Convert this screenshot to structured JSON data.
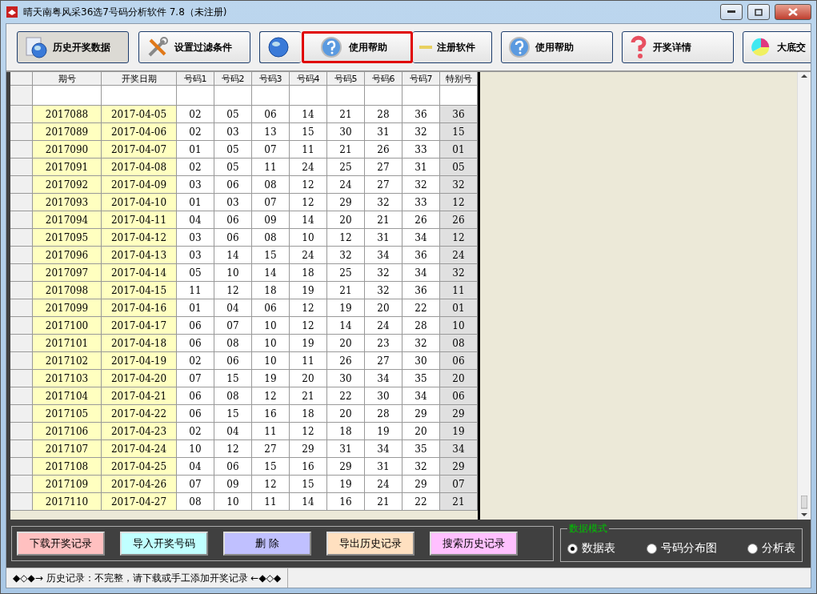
{
  "window": {
    "title": "晴天南粤风采36选7号码分析软件 7.8（未注册)"
  },
  "toolbar": [
    {
      "label": "历史开奖数据",
      "selected": true
    },
    {
      "label": "设置过滤条件",
      "selected": false
    },
    {
      "selected": false
    },
    {
      "label": "注册软件",
      "selected": false
    },
    {
      "label": "使用帮助",
      "selected": false
    },
    {
      "label": "开奖详情",
      "selected": false
    },
    {
      "label": "大底交",
      "selected": false
    }
  ],
  "highlight_button": {
    "label": "使用帮助"
  },
  "table": {
    "columns": [
      "期号",
      "开奖日期",
      "号码1",
      "号码2",
      "号码3",
      "号码4",
      "号码5",
      "号码6",
      "号码7",
      "特别号"
    ],
    "rows": [
      [
        "2017088",
        "2017-04-05",
        "02",
        "05",
        "06",
        "14",
        "21",
        "28",
        "36",
        "36"
      ],
      [
        "2017089",
        "2017-04-06",
        "02",
        "03",
        "13",
        "15",
        "30",
        "31",
        "32",
        "15"
      ],
      [
        "2017090",
        "2017-04-07",
        "01",
        "05",
        "07",
        "11",
        "21",
        "26",
        "33",
        "01"
      ],
      [
        "2017091",
        "2017-04-08",
        "02",
        "05",
        "11",
        "24",
        "25",
        "27",
        "31",
        "05"
      ],
      [
        "2017092",
        "2017-04-09",
        "03",
        "06",
        "08",
        "12",
        "24",
        "27",
        "32",
        "32"
      ],
      [
        "2017093",
        "2017-04-10",
        "01",
        "03",
        "07",
        "12",
        "29",
        "32",
        "33",
        "12"
      ],
      [
        "2017094",
        "2017-04-11",
        "04",
        "06",
        "09",
        "14",
        "20",
        "21",
        "26",
        "26"
      ],
      [
        "2017095",
        "2017-04-12",
        "03",
        "06",
        "08",
        "10",
        "12",
        "31",
        "34",
        "12"
      ],
      [
        "2017096",
        "2017-04-13",
        "03",
        "14",
        "15",
        "24",
        "32",
        "34",
        "36",
        "24"
      ],
      [
        "2017097",
        "2017-04-14",
        "05",
        "10",
        "14",
        "18",
        "25",
        "32",
        "34",
        "32"
      ],
      [
        "2017098",
        "2017-04-15",
        "11",
        "12",
        "18",
        "19",
        "21",
        "32",
        "36",
        "11"
      ],
      [
        "2017099",
        "2017-04-16",
        "01",
        "04",
        "06",
        "12",
        "19",
        "20",
        "22",
        "01"
      ],
      [
        "2017100",
        "2017-04-17",
        "06",
        "07",
        "10",
        "12",
        "14",
        "24",
        "28",
        "10"
      ],
      [
        "2017101",
        "2017-04-18",
        "06",
        "08",
        "10",
        "19",
        "20",
        "23",
        "32",
        "08"
      ],
      [
        "2017102",
        "2017-04-19",
        "02",
        "06",
        "10",
        "11",
        "26",
        "27",
        "30",
        "06"
      ],
      [
        "2017103",
        "2017-04-20",
        "07",
        "15",
        "19",
        "20",
        "30",
        "34",
        "35",
        "20"
      ],
      [
        "2017104",
        "2017-04-21",
        "06",
        "08",
        "12",
        "21",
        "22",
        "30",
        "34",
        "06"
      ],
      [
        "2017105",
        "2017-04-22",
        "06",
        "15",
        "16",
        "18",
        "20",
        "28",
        "29",
        "29"
      ],
      [
        "2017106",
        "2017-04-23",
        "02",
        "04",
        "11",
        "12",
        "18",
        "19",
        "20",
        "19"
      ],
      [
        "2017107",
        "2017-04-24",
        "10",
        "12",
        "27",
        "29",
        "31",
        "34",
        "35",
        "34"
      ],
      [
        "2017108",
        "2017-04-25",
        "04",
        "06",
        "15",
        "16",
        "29",
        "31",
        "32",
        "29"
      ],
      [
        "2017109",
        "2017-04-26",
        "07",
        "09",
        "12",
        "15",
        "19",
        "24",
        "29",
        "07"
      ],
      [
        "2017110",
        "2017-04-27",
        "08",
        "10",
        "11",
        "14",
        "16",
        "21",
        "22",
        "21"
      ]
    ]
  },
  "actions": [
    {
      "label": "下载开奖记录",
      "color": "#ffc0c0"
    },
    {
      "label": "导入开奖号码",
      "color": "#c0ffff"
    },
    {
      "label": "删 除",
      "color": "#c0c0ff"
    },
    {
      "label": "导出历史记录",
      "color": "#ffe0c0"
    },
    {
      "label": "搜索历史记录",
      "color": "#ffc0ff"
    }
  ],
  "data_mode": {
    "title": "数据模式",
    "options": [
      {
        "label": "数据表",
        "selected": true
      },
      {
        "label": "号码分布图",
        "selected": false
      },
      {
        "label": "分析表",
        "selected": false
      }
    ]
  },
  "status_bar": "◆◇◆→ 历史记录：不完整，请下载或手工添加开奖记录 ←◆◇◆"
}
